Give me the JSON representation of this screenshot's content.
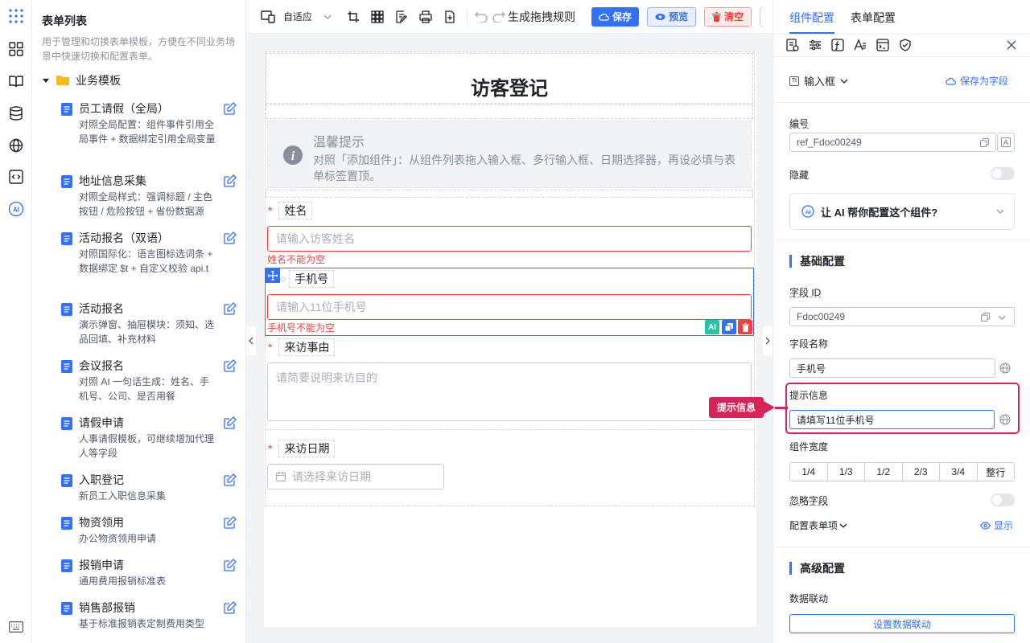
{
  "sidebar": {
    "title": "表单列表",
    "description": "用于管理和切换表单模板，方便在不同业务场景中快速切换和配置表单。",
    "folder": "业务模板",
    "templates": [
      {
        "name": "员工请假（全局）",
        "desc": "对照全局配置：组件事件引用全局事件 + 数据绑定引用全局变量"
      },
      {
        "name": "地址信息采集",
        "desc": "对照全局样式：强调标题 / 主色按钮 / 危险按钮 + 省份数据源"
      },
      {
        "name": "活动报名（双语）",
        "desc": "对照国际化：语言图标选词条 + 数据绑定 $t + 自定义校验 api.t"
      },
      {
        "name": "活动报名",
        "desc": "演示弹窗、抽屉模块：须知、选品回填、补充材料"
      },
      {
        "name": "会议报名",
        "desc": "对照 AI 一句话生成：姓名、手机号、公司、是否用餐"
      },
      {
        "name": "请假申请",
        "desc": "人事请假模板，可继续增加代理人等字段"
      },
      {
        "name": "入职登记",
        "desc": "新员工入职信息采集"
      },
      {
        "name": "物资领用",
        "desc": "办公物资领用申请"
      },
      {
        "name": "报销申请",
        "desc": "通用费用报销标准表"
      },
      {
        "name": "销售部报销",
        "desc": "基于标准报销表定制费用类型"
      }
    ]
  },
  "toolbar": {
    "layout_mode": "自适应",
    "generate_rules": "生成拖拽规则",
    "save": "保存",
    "preview": "预览",
    "clear": "清空"
  },
  "form": {
    "title": "访客登记",
    "tip_title": "温馨提示",
    "tip_text": "对照「添加组件」：从组件列表拖入输入框、多行输入框、日期选择器，再设必填与表单标签置顶。",
    "fields": {
      "name_label": "姓名",
      "name_placeholder": "请输入访客姓名",
      "name_error": "姓名不能为空",
      "phone_label": "手机号",
      "phone_placeholder": "请输入11位手机号",
      "phone_error": "手机号不能为空",
      "reason_label": "来访事由",
      "reason_placeholder": "请简要说明来访目的",
      "date_label": "来访日期",
      "date_placeholder": "请选择来访日期"
    }
  },
  "right_panel": {
    "tab_component": "组件配置",
    "tab_form": "表单配置",
    "component_type": "输入框",
    "save_as_field": "保存为字段",
    "id_label": "编号",
    "id_value": "ref_Fdoc00249",
    "hidden_label": "隐藏",
    "ai_prompt": "让 AI 帮你配置这个组件?",
    "basic_section": "基础配置",
    "field_id_label": "字段 ID",
    "field_id_value": "Fdoc00249",
    "field_name_label": "字段名称",
    "field_name_value": "手机号",
    "tip_label": "提示信息",
    "tip_value": "请填写11位手机号",
    "width_label": "组件宽度",
    "width_options": [
      "1/4",
      "1/3",
      "1/2",
      "2/3",
      "3/4",
      "整行"
    ],
    "ignore_label": "忽略字段",
    "config_items_label": "配置表单项",
    "show_label": "显示",
    "advanced_section": "高级配置",
    "linkage_label": "数据联动",
    "linkage_button": "设置数据联动"
  },
  "callout": {
    "text": "提示信息"
  },
  "colors": {
    "primary": "#3370ff",
    "danger": "#f53f3f",
    "highlight": "#d4245a"
  }
}
